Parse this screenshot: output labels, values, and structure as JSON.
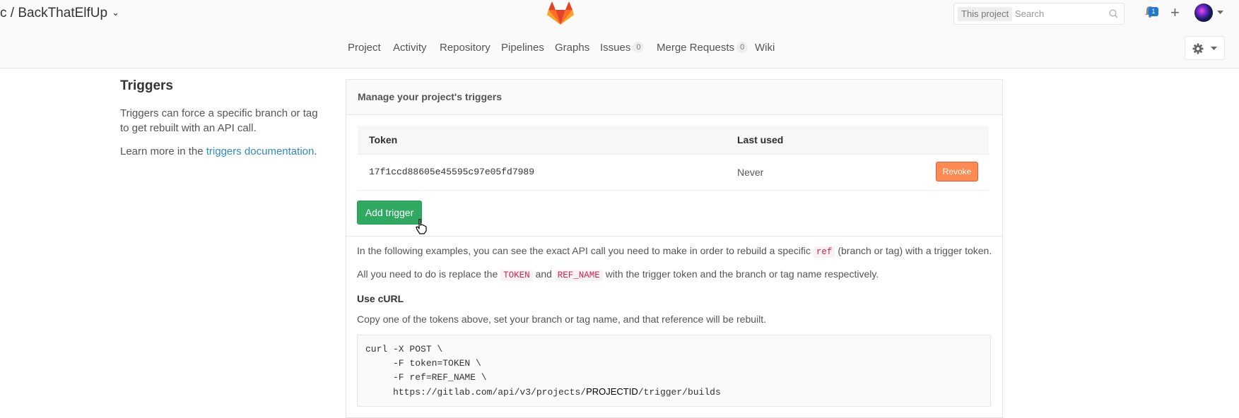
{
  "header": {
    "title": "c / BackThatElfUp",
    "search_scope": "This project",
    "search_placeholder": "Search",
    "notifications_count": "1"
  },
  "nav": [
    {
      "label": "Project"
    },
    {
      "label": "Activity"
    },
    {
      "label": "Repository"
    },
    {
      "label": "Pipelines"
    },
    {
      "label": "Graphs"
    },
    {
      "label": "Issues",
      "count": "0"
    },
    {
      "label": "Merge Requests",
      "count": "0"
    },
    {
      "label": "Wiki"
    }
  ],
  "sidebar": {
    "title": "Triggers",
    "description": "Triggers can force a specific branch or tag to get rebuilt with an API call.",
    "learn_prefix": "Learn more in the",
    "learn_link": "triggers documentation",
    "learn_suffix": "."
  },
  "panel": {
    "heading": "Manage your project's triggers",
    "columns": [
      "Token",
      "Last used"
    ],
    "rows": [
      {
        "token": "17f1ccd88605e45595c97e05fd7989",
        "last_used": "Never",
        "action": "Revoke"
      }
    ],
    "add_button": "Add trigger"
  },
  "info": {
    "line1_a": "In the following examples, you can see the exact API call you need to make in order to rebuild a specific",
    "line1_code": "ref",
    "line1_b": "(branch or tag) with a trigger token.",
    "line2_a": "All you need to do is replace the",
    "line2_code1": "TOKEN",
    "line2_and": "and",
    "line2_code2": "REF_NAME",
    "line2_b": "with the trigger token and the branch or tag name respectively.",
    "curl_heading": "Use cURL",
    "curl_desc": "Copy one of the tokens above, set your branch or tag name, and that reference will be rebuilt.",
    "code_lines": [
      "curl -X POST \\",
      "     -F token=TOKEN \\",
      "     -F ref=REF_NAME \\"
    ],
    "code_url_a": "     https://gitlab.com/api/v3/projects/",
    "code_url_pid": "PROJECTID",
    "code_url_b": "/trigger/builds"
  }
}
